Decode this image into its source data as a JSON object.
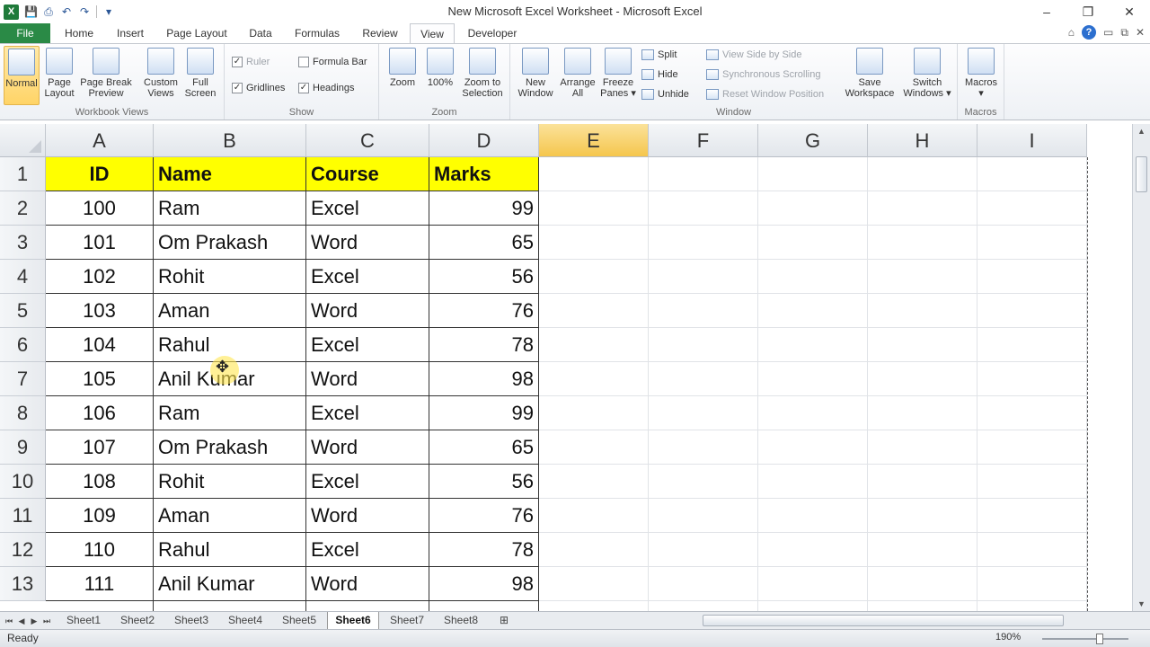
{
  "window": {
    "title": "New Microsoft Excel Worksheet - Microsoft Excel",
    "controls": {
      "minimize": "–",
      "restore": "❐",
      "close": "✕"
    }
  },
  "qat": {
    "logo": "X",
    "save": "💾",
    "print": "⎙",
    "undo": "↶",
    "redo": "↷",
    "more": "▾"
  },
  "tabs": {
    "file": "File",
    "items": [
      "Home",
      "Insert",
      "Page Layout",
      "Data",
      "Formulas",
      "Review",
      "View",
      "Developer"
    ],
    "active": "View",
    "right_icons": {
      "collapse": "⌂",
      "help": "?",
      "min": "▭",
      "restore": "⧉",
      "close": "✕"
    }
  },
  "ribbon": {
    "workbook_views": {
      "label": "Workbook Views",
      "normal": "Normal",
      "page_layout_1": "Page",
      "page_layout_2": "Layout",
      "page_break_1": "Page Break",
      "page_break_2": "Preview",
      "custom_1": "Custom",
      "custom_2": "Views",
      "full_1": "Full",
      "full_2": "Screen"
    },
    "show": {
      "label": "Show",
      "ruler": "Ruler",
      "formula_bar": "Formula Bar",
      "gridlines": "Gridlines",
      "headings": "Headings"
    },
    "zoom": {
      "label": "Zoom",
      "zoom": "Zoom",
      "hundred": "100%",
      "sel_1": "Zoom to",
      "sel_2": "Selection"
    },
    "window": {
      "label": "Window",
      "new_1": "New",
      "new_2": "Window",
      "arrange_1": "Arrange",
      "arrange_2": "All",
      "freeze_1": "Freeze",
      "freeze_2": "Panes ▾",
      "split": "Split",
      "hide": "Hide",
      "unhide": "Unhide",
      "side": "View Side by Side",
      "sync": "Synchronous Scrolling",
      "reset": "Reset Window Position",
      "save_1": "Save",
      "save_2": "Workspace",
      "switch_1": "Switch",
      "switch_2": "Windows ▾"
    },
    "macros": {
      "label": "Macros",
      "macros": "Macros",
      "arrow": "▾"
    }
  },
  "sheet": {
    "columns": [
      "A",
      "B",
      "C",
      "D",
      "E",
      "F",
      "G",
      "H",
      "I"
    ],
    "selected_column": "E",
    "rows": [
      "1",
      "2",
      "3",
      "4",
      "5",
      "6",
      "7",
      "8",
      "9",
      "10",
      "11",
      "12",
      "13"
    ],
    "header": [
      "ID",
      "Name",
      "Course",
      "Marks"
    ],
    "data": [
      [
        "100",
        "Ram",
        "Excel",
        "99"
      ],
      [
        "101",
        "Om Prakash",
        "Word",
        "65"
      ],
      [
        "102",
        "Rohit",
        "Excel",
        "56"
      ],
      [
        "103",
        "Aman",
        "Word",
        "76"
      ],
      [
        "104",
        "Rahul",
        "Excel",
        "78"
      ],
      [
        "105",
        "Anil Kumar",
        "Word",
        "98"
      ],
      [
        "106",
        "Ram",
        "Excel",
        "99"
      ],
      [
        "107",
        "Om Prakash",
        "Word",
        "65"
      ],
      [
        "108",
        "Rohit",
        "Excel",
        "56"
      ],
      [
        "109",
        "Aman",
        "Word",
        "76"
      ],
      [
        "110",
        "Rahul",
        "Excel",
        "78"
      ],
      [
        "111",
        "Anil Kumar",
        "Word",
        "98"
      ]
    ],
    "header_color": "#ffff00"
  },
  "sheet_tabs": {
    "items": [
      "Sheet1",
      "Sheet2",
      "Sheet3",
      "Sheet4",
      "Sheet5",
      "Sheet6",
      "Sheet7",
      "Sheet8"
    ],
    "active": "Sheet6",
    "nav": {
      "first": "⏮",
      "prev": "◀",
      "next": "▶",
      "last": "⏭"
    }
  },
  "status": {
    "ready": "Ready",
    "zoom": "190%"
  },
  "scroll": {
    "up": "▲",
    "down": "▼"
  }
}
